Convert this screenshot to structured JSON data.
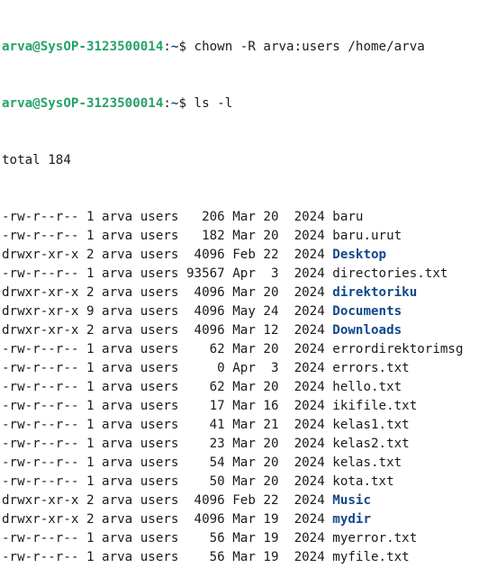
{
  "prompt": {
    "user_host": "arva@SysOP-3123500014",
    "separator": ":",
    "path": "~",
    "symbol": "$"
  },
  "commands": [
    " chown -R arva:users /home/arva",
    " ls -l"
  ],
  "total_line": "total 184",
  "colors": {
    "prompt_user": "#26a269",
    "directory": "#12488b",
    "text": "#1a1a1a",
    "background": "#ffffff"
  },
  "listing": [
    {
      "perms": "-rw-r--r--",
      "links": "1",
      "owner": "arva",
      "group": "users",
      "size": "206",
      "month": "Mar",
      "day": "20",
      "year": "2024",
      "name": "baru",
      "is_dir": false
    },
    {
      "perms": "-rw-r--r--",
      "links": "1",
      "owner": "arva",
      "group": "users",
      "size": "182",
      "month": "Mar",
      "day": "20",
      "year": "2024",
      "name": "baru.urut",
      "is_dir": false
    },
    {
      "perms": "drwxr-xr-x",
      "links": "2",
      "owner": "arva",
      "group": "users",
      "size": "4096",
      "month": "Feb",
      "day": "22",
      "year": "2024",
      "name": "Desktop",
      "is_dir": true
    },
    {
      "perms": "-rw-r--r--",
      "links": "1",
      "owner": "arva",
      "group": "users",
      "size": "93567",
      "month": "Apr",
      "day": "3",
      "year": "2024",
      "name": "directories.txt",
      "is_dir": false
    },
    {
      "perms": "drwxr-xr-x",
      "links": "2",
      "owner": "arva",
      "group": "users",
      "size": "4096",
      "month": "Mar",
      "day": "20",
      "year": "2024",
      "name": "direktoriku",
      "is_dir": true
    },
    {
      "perms": "drwxr-xr-x",
      "links": "9",
      "owner": "arva",
      "group": "users",
      "size": "4096",
      "month": "May",
      "day": "24",
      "year": "2024",
      "name": "Documents",
      "is_dir": true
    },
    {
      "perms": "drwxr-xr-x",
      "links": "2",
      "owner": "arva",
      "group": "users",
      "size": "4096",
      "month": "Mar",
      "day": "12",
      "year": "2024",
      "name": "Downloads",
      "is_dir": true
    },
    {
      "perms": "-rw-r--r--",
      "links": "1",
      "owner": "arva",
      "group": "users",
      "size": "62",
      "month": "Mar",
      "day": "20",
      "year": "2024",
      "name": "errordirektorimsg",
      "is_dir": false
    },
    {
      "perms": "-rw-r--r--",
      "links": "1",
      "owner": "arva",
      "group": "users",
      "size": "0",
      "month": "Apr",
      "day": "3",
      "year": "2024",
      "name": "errors.txt",
      "is_dir": false
    },
    {
      "perms": "-rw-r--r--",
      "links": "1",
      "owner": "arva",
      "group": "users",
      "size": "62",
      "month": "Mar",
      "day": "20",
      "year": "2024",
      "name": "hello.txt",
      "is_dir": false
    },
    {
      "perms": "-rw-r--r--",
      "links": "1",
      "owner": "arva",
      "group": "users",
      "size": "17",
      "month": "Mar",
      "day": "16",
      "year": "2024",
      "name": "ikifile.txt",
      "is_dir": false
    },
    {
      "perms": "-rw-r--r--",
      "links": "1",
      "owner": "arva",
      "group": "users",
      "size": "41",
      "month": "Mar",
      "day": "21",
      "year": "2024",
      "name": "kelas1.txt",
      "is_dir": false
    },
    {
      "perms": "-rw-r--r--",
      "links": "1",
      "owner": "arva",
      "group": "users",
      "size": "23",
      "month": "Mar",
      "day": "20",
      "year": "2024",
      "name": "kelas2.txt",
      "is_dir": false
    },
    {
      "perms": "-rw-r--r--",
      "links": "1",
      "owner": "arva",
      "group": "users",
      "size": "54",
      "month": "Mar",
      "day": "20",
      "year": "2024",
      "name": "kelas.txt",
      "is_dir": false
    },
    {
      "perms": "-rw-r--r--",
      "links": "1",
      "owner": "arva",
      "group": "users",
      "size": "50",
      "month": "Mar",
      "day": "20",
      "year": "2024",
      "name": "kota.txt",
      "is_dir": false
    },
    {
      "perms": "drwxr-xr-x",
      "links": "2",
      "owner": "arva",
      "group": "users",
      "size": "4096",
      "month": "Feb",
      "day": "22",
      "year": "2024",
      "name": "Music",
      "is_dir": true
    },
    {
      "perms": "drwxr-xr-x",
      "links": "2",
      "owner": "arva",
      "group": "users",
      "size": "4096",
      "month": "Mar",
      "day": "19",
      "year": "2024",
      "name": "mydir",
      "is_dir": true
    },
    {
      "perms": "-rw-r--r--",
      "links": "1",
      "owner": "arva",
      "group": "users",
      "size": "56",
      "month": "Mar",
      "day": "19",
      "year": "2024",
      "name": "myerror.txt",
      "is_dir": false
    },
    {
      "perms": "-rw-r--r--",
      "links": "1",
      "owner": "arva",
      "group": "users",
      "size": "56",
      "month": "Mar",
      "day": "19",
      "year": "2024",
      "name": "myfile.txt",
      "is_dir": false
    }
  ]
}
